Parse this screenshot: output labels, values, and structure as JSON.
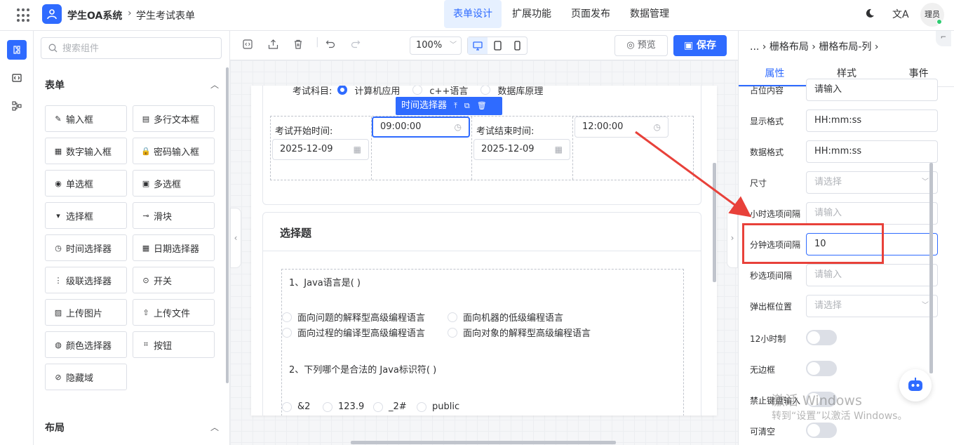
{
  "app": {
    "title": "学生OA系统",
    "breadcrumb_sep": "›",
    "breadcrumb": "学生考试表单",
    "avatar": "理员"
  },
  "topnav": [
    "表单设计",
    "扩展功能",
    "页面发布",
    "数据管理"
  ],
  "components": {
    "search_placeholder": "搜索组件",
    "section_form": "表单",
    "section_layout": "布局",
    "items": [
      {
        "label": "输入框",
        "icon": "✎"
      },
      {
        "label": "多行文本框",
        "icon": "▤"
      },
      {
        "label": "数字输入框",
        "icon": "▦"
      },
      {
        "label": "密码输入框",
        "icon": "🔒"
      },
      {
        "label": "单选框",
        "icon": "◉"
      },
      {
        "label": "多选框",
        "icon": "▣"
      },
      {
        "label": "选择框",
        "icon": "▾"
      },
      {
        "label": "滑块",
        "icon": "⊸"
      },
      {
        "label": "时间选择器",
        "icon": "◷"
      },
      {
        "label": "日期选择器",
        "icon": "▦"
      },
      {
        "label": "级联选择器",
        "icon": "⋮"
      },
      {
        "label": "开关",
        "icon": "⊙"
      },
      {
        "label": "上传图片",
        "icon": "▨"
      },
      {
        "label": "上传文件",
        "icon": "⇧"
      },
      {
        "label": "颜色选择器",
        "icon": "◍"
      },
      {
        "label": "按钮",
        "icon": "⌗"
      },
      {
        "label": "隐藏域",
        "icon": "⊘"
      }
    ]
  },
  "toolbar": {
    "zoom": "100%",
    "preview": "预览",
    "save": "保存"
  },
  "canvas": {
    "subject_label": "考试科目:",
    "subject_options": [
      "计算机应用",
      "c++语言",
      "数据库原理"
    ],
    "float_tag": "时间选择器",
    "start_label": "考试开始时间:",
    "start_date": "2025-12-09",
    "start_time": "09:00:00",
    "end_label": "考试结束时间:",
    "end_date": "2025-12-09",
    "end_time": "12:00:00",
    "section_title": "选择题",
    "q1": "1、Java语言是( )",
    "q1_opts": [
      "面向问题的解释型高级编程语言",
      "面向机器的低级编程语言",
      "面向过程的编译型高级编程语言",
      "面向对象的解释型高级编程语言"
    ],
    "q2": "2、下列哪个是合法的 Java标识符( )",
    "q2_opts": [
      "&2",
      "123.9",
      "_2#",
      "public"
    ]
  },
  "props": {
    "breadcrumb": "... › 栅格布局 › 栅格布局-列 ›",
    "tabs": [
      "属性",
      "样式",
      "事件"
    ],
    "rows": [
      {
        "label": "占位内容",
        "value": "请输入",
        "placeholder": false
      },
      {
        "label": "显示格式",
        "value": "HH:mm:ss",
        "placeholder": false
      },
      {
        "label": "数据格式",
        "value": "HH:mm:ss",
        "placeholder": false
      },
      {
        "label": "尺寸",
        "value": "请选择",
        "placeholder": true
      },
      {
        "label": "小时选项间隔",
        "value": "请输入",
        "placeholder": true
      },
      {
        "label": "分钟选项间隔",
        "value": "10",
        "placeholder": false
      },
      {
        "label": "秒选项间隔",
        "value": "请输入",
        "placeholder": true
      },
      {
        "label": "弹出框位置",
        "value": "请选择",
        "placeholder": true
      }
    ],
    "toggles": [
      "12小时制",
      "无边框",
      "禁止键盘输入",
      "可清空"
    ]
  },
  "watermark": {
    "line1": "激活 Windows",
    "line2": "转到“设置”以激活 Windows。"
  },
  "colors": {
    "accent": "#2f6bff",
    "annotation": "#e8413a"
  }
}
